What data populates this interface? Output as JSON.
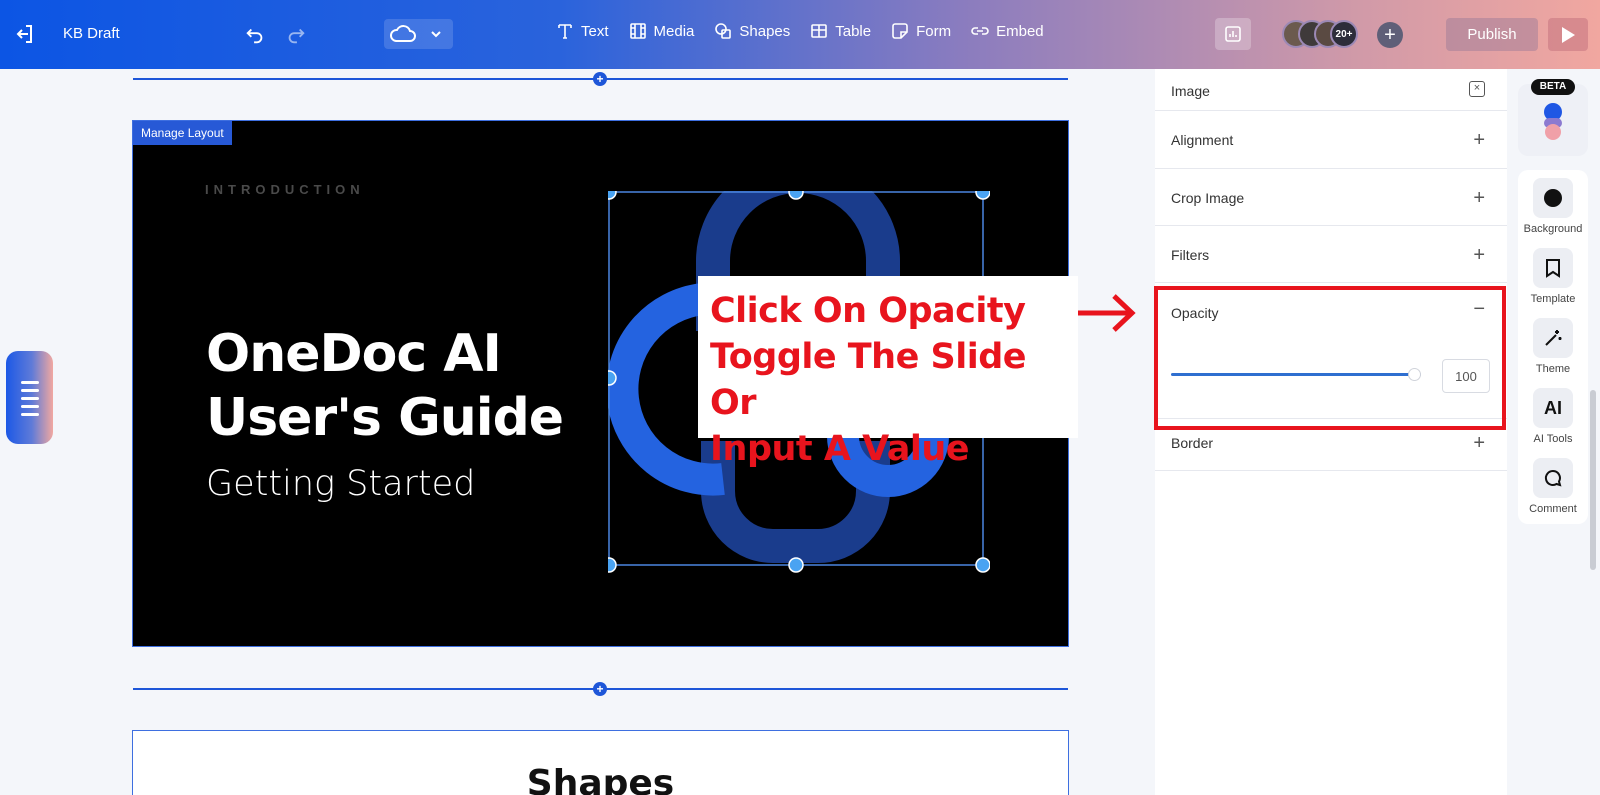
{
  "topbar": {
    "doc_title": "KB Draft",
    "tools": [
      {
        "label": "Text",
        "icon": "text-icon"
      },
      {
        "label": "Media",
        "icon": "media-icon"
      },
      {
        "label": "Shapes",
        "icon": "shapes-icon"
      },
      {
        "label": "Table",
        "icon": "table-icon"
      },
      {
        "label": "Form",
        "icon": "form-icon"
      },
      {
        "label": "Embed",
        "icon": "embed-icon"
      }
    ],
    "collaborators_count": "20+",
    "publish_label": "Publish"
  },
  "slide": {
    "manage_layout": "Manage Layout",
    "kicker": "INTRODUCTION",
    "title_line1": "OneDoc AI",
    "title_line2": "User's Guide",
    "subtitle": "Getting Started"
  },
  "callout": {
    "line1": "Click On Opacity",
    "line2": "Toggle The Slide Or",
    "line3": "Input A Value"
  },
  "next_section": {
    "title": "Shapes"
  },
  "panel": {
    "header": "Image",
    "sections": {
      "alignment": "Alignment",
      "crop": "Crop Image",
      "filters": "Filters",
      "opacity": "Opacity",
      "border": "Border"
    },
    "opacity_value": "100",
    "opacity_fraction": 1.0
  },
  "rail": {
    "beta": "BETA",
    "items": [
      "Background",
      "Template",
      "Theme",
      "AI Tools",
      "Comment"
    ],
    "ai_glyph": "AI"
  },
  "colors": {
    "accent": "#1e56d8",
    "callout_red": "#e8141d"
  }
}
